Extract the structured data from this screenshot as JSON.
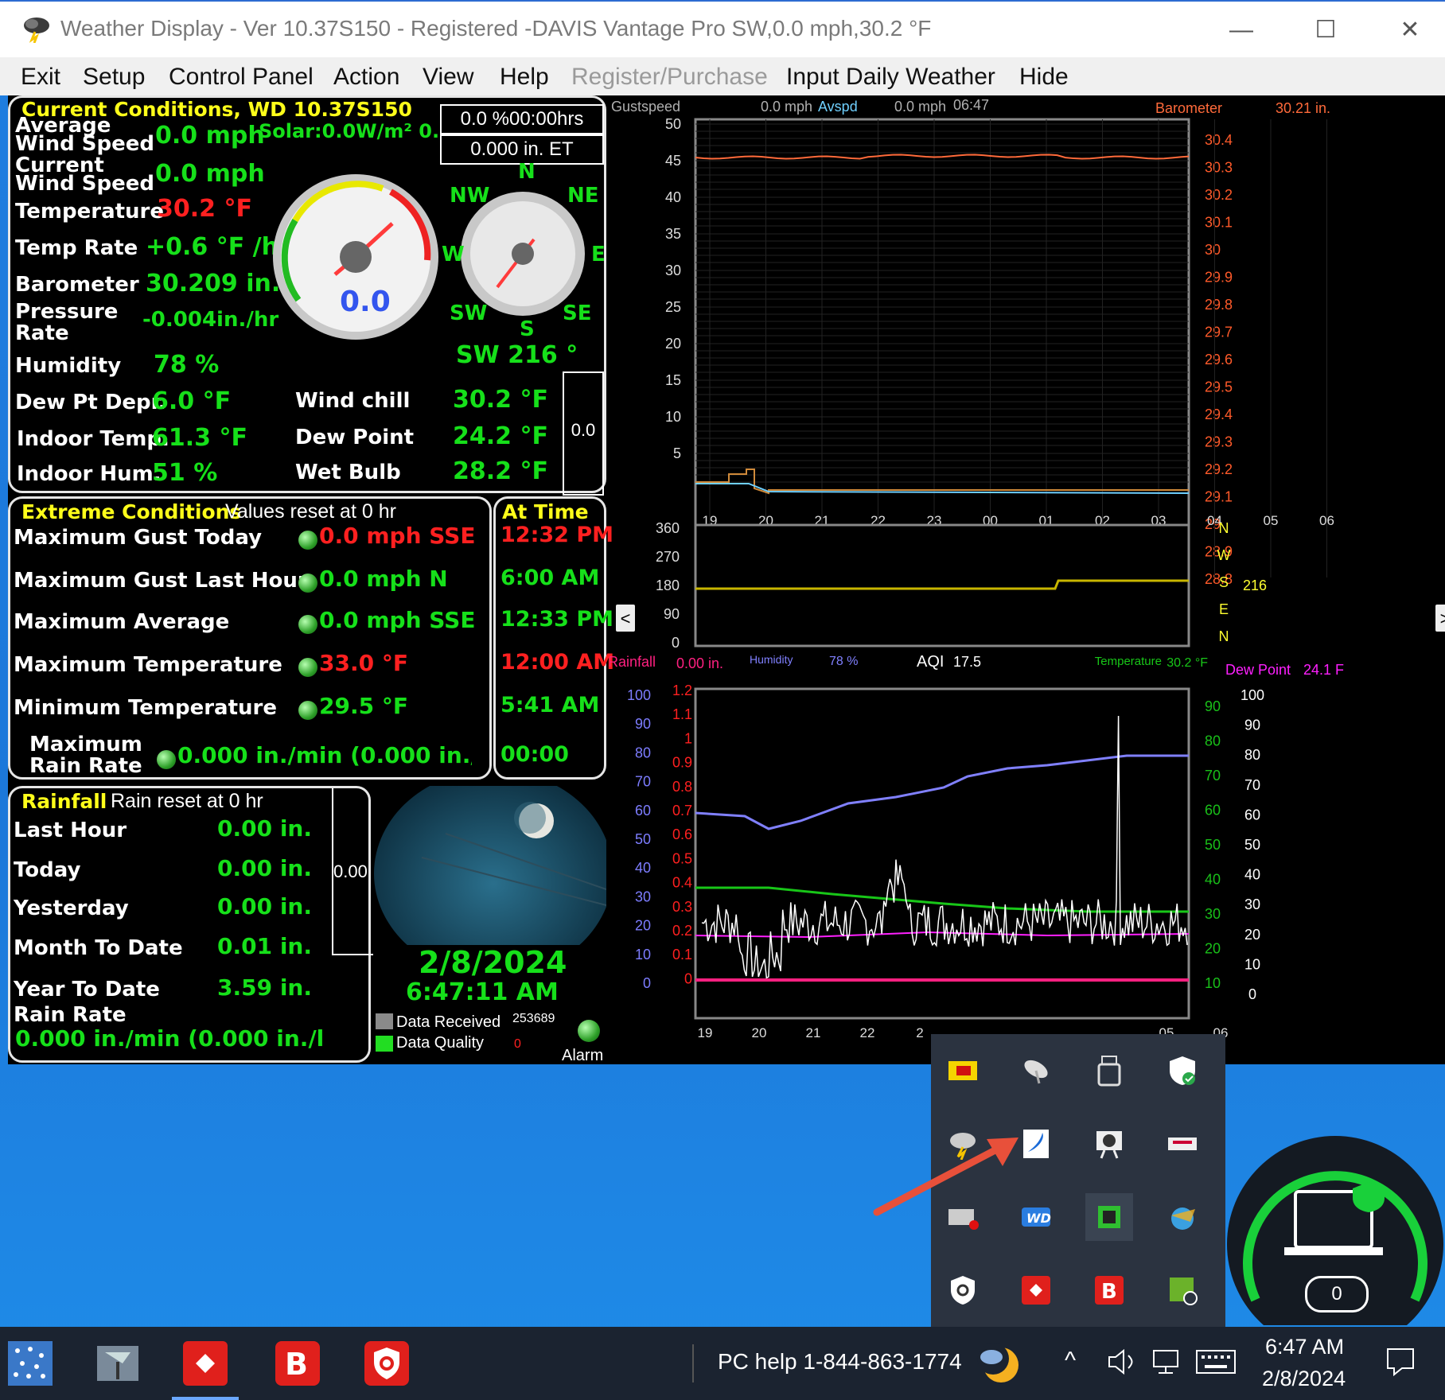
{
  "window": {
    "title": "Weather Display - Ver 10.37S150 - Registered  -DAVIS Vantage Pro  SW,0.0 mph,30.2 °F",
    "min_label": "—",
    "max_label": "☐",
    "close_label": "✕"
  },
  "menu": [
    "Exit",
    "Setup",
    "Control Panel",
    "Action",
    "View",
    "Help",
    "Register/Purchase",
    "Input Daily Weather",
    "Hide"
  ],
  "current": {
    "header": "Current Conditions, WD 10.37S150",
    "avg_wind_label_1": "Average",
    "avg_wind_label_2": "Wind Speed",
    "avg_wind_value": "0.0 mph",
    "solar": "Solar:0.0W/m² 0.",
    "cur_wind_label_1": "Current",
    "cur_wind_label_2": "Wind Speed",
    "cur_wind_value": "0.0 mph",
    "temp_label": "Temperature",
    "temp_value": "30.2 °F",
    "temp_rate_label": "Temp Rate",
    "temp_rate_value": "+0.6 °F /hr",
    "baro_label": "Barometer",
    "baro_value": "30.209 in.",
    "pressure_rate_label_1": "Pressure",
    "pressure_rate_label_2": "Rate",
    "pressure_rate_value": "-0.004in./hr",
    "humidity_label": "Humidity",
    "humidity_value": "78 %",
    "dewdepr_label": "Dew Pt Depr.",
    "dewdepr_value": "6.0 °F",
    "indoor_temp_label": "Indoor Temp.",
    "indoor_temp_value": "61.3 °F",
    "indoor_hum_label": "Indoor Hum.",
    "indoor_hum_value": "51 %",
    "windchill_label": "Wind chill",
    "windchill_value": "30.2 °F",
    "dewpoint_label": "Dew Point",
    "dewpoint_value": "24.2 °F",
    "wetbulb_label": "Wet Bulb",
    "wetbulb_value": "28.2 °F",
    "box1": "0.0 %00:00hrs",
    "box2": "0.000 in. ET",
    "gauge_value": "0.0",
    "compass_n": "N",
    "compass_ne": "NE",
    "compass_nw": "NW",
    "compass_e": "E",
    "compass_w": "W",
    "compass_s": "S",
    "compass_se": "SE",
    "compass_sw": "SW",
    "wind_dir": "SW  216 °",
    "side_box": "0.0"
  },
  "extreme": {
    "header": "Extreme Conditions",
    "subheader": "Values reset at 0 hr",
    "at_time_header": "At Time",
    "rows": [
      {
        "label": "Maximum Gust Today",
        "value": "0.0 mph SSE",
        "time": "12:32 PM",
        "red": true
      },
      {
        "label": "Maximum Gust Last Hour",
        "value": "0.0 mph  N",
        "time": "6:00 AM",
        "red": false
      },
      {
        "label": "Maximum Average",
        "value": "0.0 mph SSE",
        "time": "12:33 PM",
        "red": false
      },
      {
        "label": "Maximum Temperature",
        "value": "33.0 °F",
        "time": "12:00 AM",
        "red": true
      },
      {
        "label": "Minimum Temperature",
        "value": "29.5 °F",
        "time": "5:41 AM",
        "red": false
      }
    ],
    "rain_rate_label_1": "Maximum",
    "rain_rate_label_2": "Rain Rate",
    "rain_rate_value": "0.000 in./min (0.000 in./l",
    "rain_rate_time": "00:00"
  },
  "rainfall": {
    "header": "Rainfall",
    "subheader": "Rain reset at 0 hr",
    "rows": [
      {
        "label": "Last Hour",
        "value": "0.00 in."
      },
      {
        "label": "Today",
        "value": "0.00 in."
      },
      {
        "label": "Yesterday",
        "value": "0.00 in."
      },
      {
        "label": "Month To Date",
        "value": "0.01 in."
      },
      {
        "label": "Year To Date",
        "value": "3.59 in."
      }
    ],
    "rain_rate_label": "Rain Rate",
    "rain_rate_value": "0.000 in./min (0.000 in./l",
    "side_box": "0.00"
  },
  "status": {
    "date": "2/8/2024",
    "time": "6:47:11 AM",
    "data_received_label": "Data Received",
    "data_received_value": "253689",
    "data_quality_label": "Data Quality",
    "data_quality_value": "0",
    "alarm_label": "Alarm"
  },
  "graph_top": {
    "gustspeed_label": "Gustspeed",
    "gustspeed_value": "0.0 mph",
    "avspd_label": "Avspd",
    "avspd_value": "0.0 mph",
    "time": "06:47",
    "baro_label": "Barometer",
    "baro_value": "30.21 in.",
    "y_left": [
      "50",
      "45",
      "40",
      "35",
      "30",
      "25",
      "20",
      "15",
      "10",
      "5"
    ],
    "y_right": [
      "30.4",
      "30.3",
      "30.2",
      "30.1",
      "30",
      "29.9",
      "29.8",
      "29.7",
      "29.6",
      "29.5",
      "29.4",
      "29.3",
      "29.2",
      "29.1",
      "29",
      "28.9",
      "28.8"
    ],
    "x": [
      "19",
      "20",
      "21",
      "22",
      "23",
      "00",
      "01",
      "02",
      "03",
      "04",
      "05",
      "06"
    ]
  },
  "graph_dir": {
    "y_left": [
      "360",
      "270",
      "180",
      "90",
      "0"
    ],
    "y_right": [
      "N",
      "W",
      "S",
      "E",
      "N"
    ],
    "dir_value": "216",
    "prev_label": "<",
    "next_label": ">"
  },
  "graph_bottom": {
    "rainfall_label": "Rainfall",
    "rainfall_value": "0.00 in.",
    "humidity_label": "Humidity",
    "humidity_value": "78 %",
    "aqi_label": "AQI",
    "aqi_value": "17.5",
    "temp_label": "Temperature",
    "temp_value": "30.2 °F",
    "dewpoint_label": "Dew Point",
    "dewpoint_value": "24.1 F",
    "y_hum": [
      "100",
      "90",
      "80",
      "70",
      "60",
      "50",
      "40",
      "30",
      "20",
      "10",
      "0"
    ],
    "y_rain": [
      "1.2",
      "1.1",
      "1",
      "0.9",
      "0.8",
      "0.7",
      "0.6",
      "0.5",
      "0.4",
      "0.3",
      "0.2",
      "0.1",
      "0"
    ],
    "y_temp": [
      "90",
      "80",
      "70",
      "60",
      "50",
      "40",
      "30",
      "20",
      "10"
    ],
    "y_dew": [
      "100",
      "90",
      "80",
      "70",
      "60",
      "50",
      "40",
      "30",
      "20",
      "10",
      "0"
    ],
    "x": [
      "19",
      "20",
      "21",
      "22",
      "2",
      "05",
      "06"
    ]
  },
  "taskbar": {
    "help_text": "PC help 1-844-863-1774",
    "clock_time": "6:47 AM",
    "clock_date": "2/8/2024",
    "notification_count": "0"
  },
  "colors": {
    "gust": "#d08a3a",
    "avspd": "#6fd0ff",
    "baro": "#ff6a3a",
    "dir": "#c8b600",
    "humidity": "#8080ff",
    "temp": "#18c618",
    "dew": "#ff20ff",
    "aqi": "#ffffff",
    "rain": "#ff2080"
  }
}
